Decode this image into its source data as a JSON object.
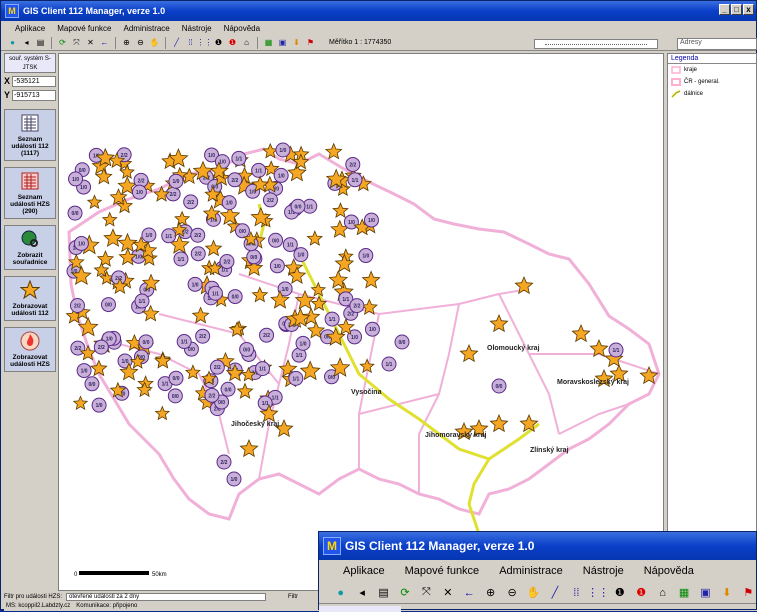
{
  "app": {
    "title": "GIS Client 112 Manager, verze 1.0",
    "logo": "M"
  },
  "window_buttons": [
    "_",
    "□",
    "x"
  ],
  "menu": [
    "Aplikace",
    "Mapové funkce",
    "Administrace",
    "Nástroje",
    "Nápověda"
  ],
  "toolbar": {
    "scale_label": "Měřítko  1 : 1774350"
  },
  "address": {
    "placeholder": "Adresy"
  },
  "coords": {
    "system_label": "souř. systém S-JTSK",
    "x_label": "X",
    "x_value": "-535121",
    "y_label": "Y",
    "y_value": "-915713"
  },
  "side_buttons": [
    {
      "label": "Seznam události 112 (1117)",
      "icon": "list-icon"
    },
    {
      "label": "Seznam události HZS (290)",
      "icon": "list-red-icon"
    },
    {
      "label": "Zobrazit souřadnice",
      "icon": "globe-icon"
    },
    {
      "label": "Zobrazovat události 112",
      "icon": "star-icon"
    },
    {
      "label": "Zobrazovat události HZS",
      "icon": "fire-icon"
    }
  ],
  "legend": {
    "title": "Legenda",
    "items": [
      {
        "label": "kraje",
        "color": "#ffb0d0"
      },
      {
        "label": "ČR - general.",
        "color": "#ffb0d0"
      },
      {
        "label": "dálnice",
        "color": "#e8e020"
      }
    ]
  },
  "map": {
    "region_labels": [
      "Olomoucký kraj",
      "Moravskoslezský kraj",
      "Vysočina",
      "Jihočeský kraj",
      "Jihomoravský kraj",
      "Zlínský kraj"
    ],
    "scalebar_start": "0",
    "scalebar_end": "50km",
    "marker_labels": [
      "0/0",
      "1/1",
      "2/2",
      "1/0"
    ],
    "colors": {
      "border": "#f0b0d8",
      "highway": "#e0e030",
      "star_fill": "#f5a623",
      "star_stroke": "#5a3a00",
      "circle_fill": "#c8b0d8",
      "circle_stroke": "#5a2a8a"
    }
  },
  "status": {
    "filter_hzs_label": "Filtr pro události HZS:",
    "filter_hzs_value": "otevřené události za 2 dny",
    "filter_label2": "Filtr",
    "ms_label": "MS: kcoppil2.Labdzty.cz",
    "comm_label": "Komunikace: připojeno"
  }
}
